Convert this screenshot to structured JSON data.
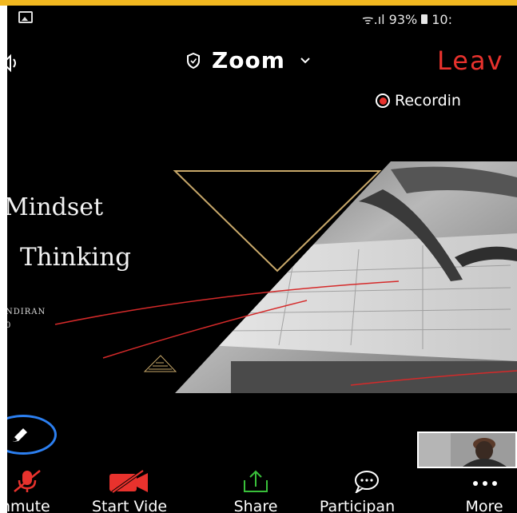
{
  "status_bar": {
    "signal_text": "ᯤ.ıl 93%",
    "time": "10:"
  },
  "header": {
    "title": "Zoom",
    "leave_label": "Leav",
    "recording_label": "Recordin"
  },
  "shared_slide": {
    "title_line1": "Mindset",
    "title_line2": "Thinking",
    "presenter_fragment": "NDIRAN",
    "presenter_fragment2": "0"
  },
  "toolbar": {
    "unmute_label": "nmute",
    "start_video_label": "Start Vide",
    "share_label": "Share",
    "participants_label": "Participan",
    "more_label": "More"
  },
  "colors": {
    "accent_red": "#e8322d",
    "share_green": "#39c03a",
    "edit_blue": "#2c7ff0",
    "slide_gold": "#c8a86a"
  }
}
